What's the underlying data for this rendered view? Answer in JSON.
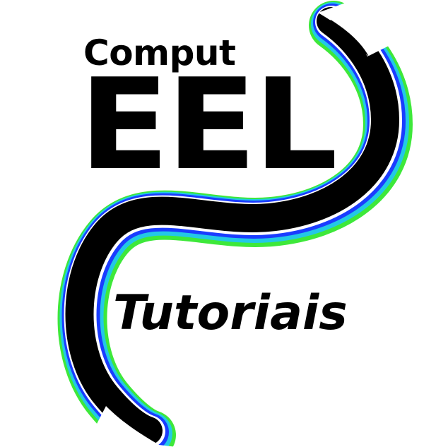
{
  "logo": {
    "line1": "Comput",
    "line2": "EEL",
    "tagline": "Tutoriais"
  },
  "colors": {
    "background": "#ffffff",
    "text": "#000000",
    "eel_body": "#000000",
    "glow_inner": "#ffffff",
    "glow_blue": "#1a3cff",
    "glow_cyan": "#23c8e6",
    "glow_green": "#3ee83a"
  },
  "icons": {
    "mascot": "eel-icon"
  }
}
